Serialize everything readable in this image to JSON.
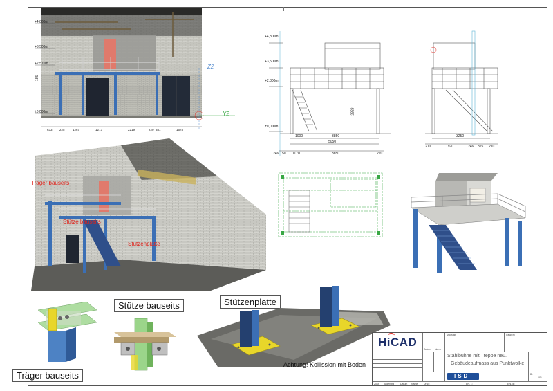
{
  "elevation_photo": {
    "levels": [
      "+4,860m",
      "+3,500m",
      "+2,570m",
      "±0,000m"
    ],
    "dims_bottom": [
      "633",
      "225",
      "1267",
      "1273",
      "2219",
      "220",
      "381",
      "1578"
    ],
    "dim_side": "185",
    "axis_labels": [
      "Z2",
      "Y2"
    ]
  },
  "front_drawing": {
    "levels": [
      "+4,800m",
      "+3,500m",
      "+2,800m",
      "±0,000m"
    ],
    "dims": [
      "1000",
      "3850",
      "5050",
      "246",
      "50",
      "1170",
      "3850",
      "220"
    ],
    "dim_vert": "2328"
  },
  "side_drawing": {
    "dims": [
      "3250",
      "210",
      "1970",
      "246",
      "825",
      "210"
    ]
  },
  "pointcloud_3d": {
    "labels": [
      "Träger bauseits",
      "Stütze bauseits",
      "Stützenplatte"
    ]
  },
  "details": {
    "traeger": "Träger bauseits",
    "stuetze": "Stütze bauseits",
    "stuetzenplatte": "Stützenplatte",
    "collision_note": "Achtung! Kollission mit Boden"
  },
  "title_block": {
    "logo_text": "HiCAD",
    "company_logo": "ISD",
    "massstab_label": "Maßstab",
    "gewicht_label": "Gewicht",
    "datum_label": "Datum",
    "name_label": "Name",
    "title_line1": "Stahlbühne mit Treppe neu.",
    "title_line2": "Gebäudeaufmass aus Punktwolke",
    "footer": [
      "Zust.",
      "Änderung",
      "Datum",
      "Name",
      "Urspr.",
      "Ers. f.:",
      "Ers. d.:"
    ],
    "blatt": "Bl.",
    "sheet_no": "1/1"
  },
  "colors": {
    "steel_blue": "#3b6fb5",
    "stair_blue": "#2f4f8a",
    "plate_yellow": "#e8d62a",
    "red_label": "#e0231b",
    "green_outline": "#39a845"
  }
}
